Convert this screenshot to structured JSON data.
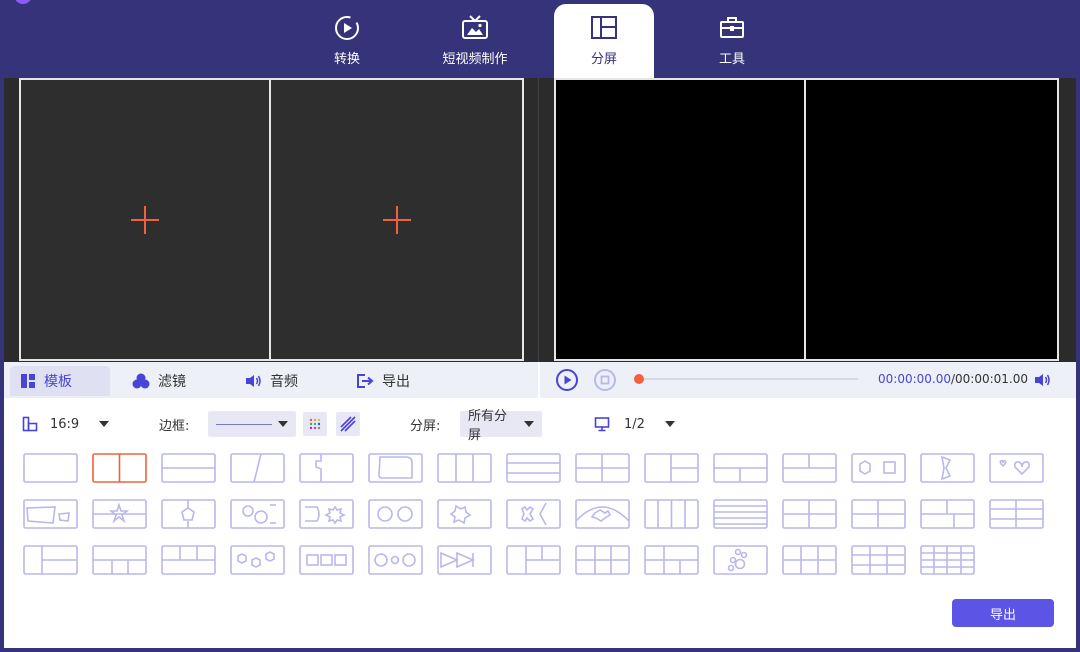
{
  "nav": {
    "tabs": [
      {
        "label": "转换",
        "icon": "convert-icon"
      },
      {
        "label": "短视频制作",
        "icon": "tv-icon"
      },
      {
        "label": "分屏",
        "icon": "split-screen-icon"
      },
      {
        "label": "工具",
        "icon": "toolbox-icon"
      }
    ],
    "active_index": 2
  },
  "subtabs": [
    {
      "label": "模板",
      "icon": "template-icon"
    },
    {
      "label": "滤镜",
      "icon": "filter-icon"
    },
    {
      "label": "音频",
      "icon": "audio-icon"
    },
    {
      "label": "导出",
      "icon": "export-icon"
    }
  ],
  "player": {
    "current_time": "00:00:00.00",
    "separator": "/",
    "total_time": "00:00:01.00",
    "progress": 0
  },
  "options": {
    "aspect_ratio": "16:9",
    "border_label": "边框:",
    "split_label": "分屏:",
    "split_value": "所有分屏",
    "page_indicator": "1/2"
  },
  "templates": {
    "count": 44,
    "selected_index": 1
  },
  "export_button": "导出",
  "colors": {
    "header_bg": "#35337a",
    "accent": "#5b54e4",
    "template_stroke": "#b8b8ec",
    "selected_stroke": "#f0623f",
    "plus_color": "#f0623f"
  }
}
